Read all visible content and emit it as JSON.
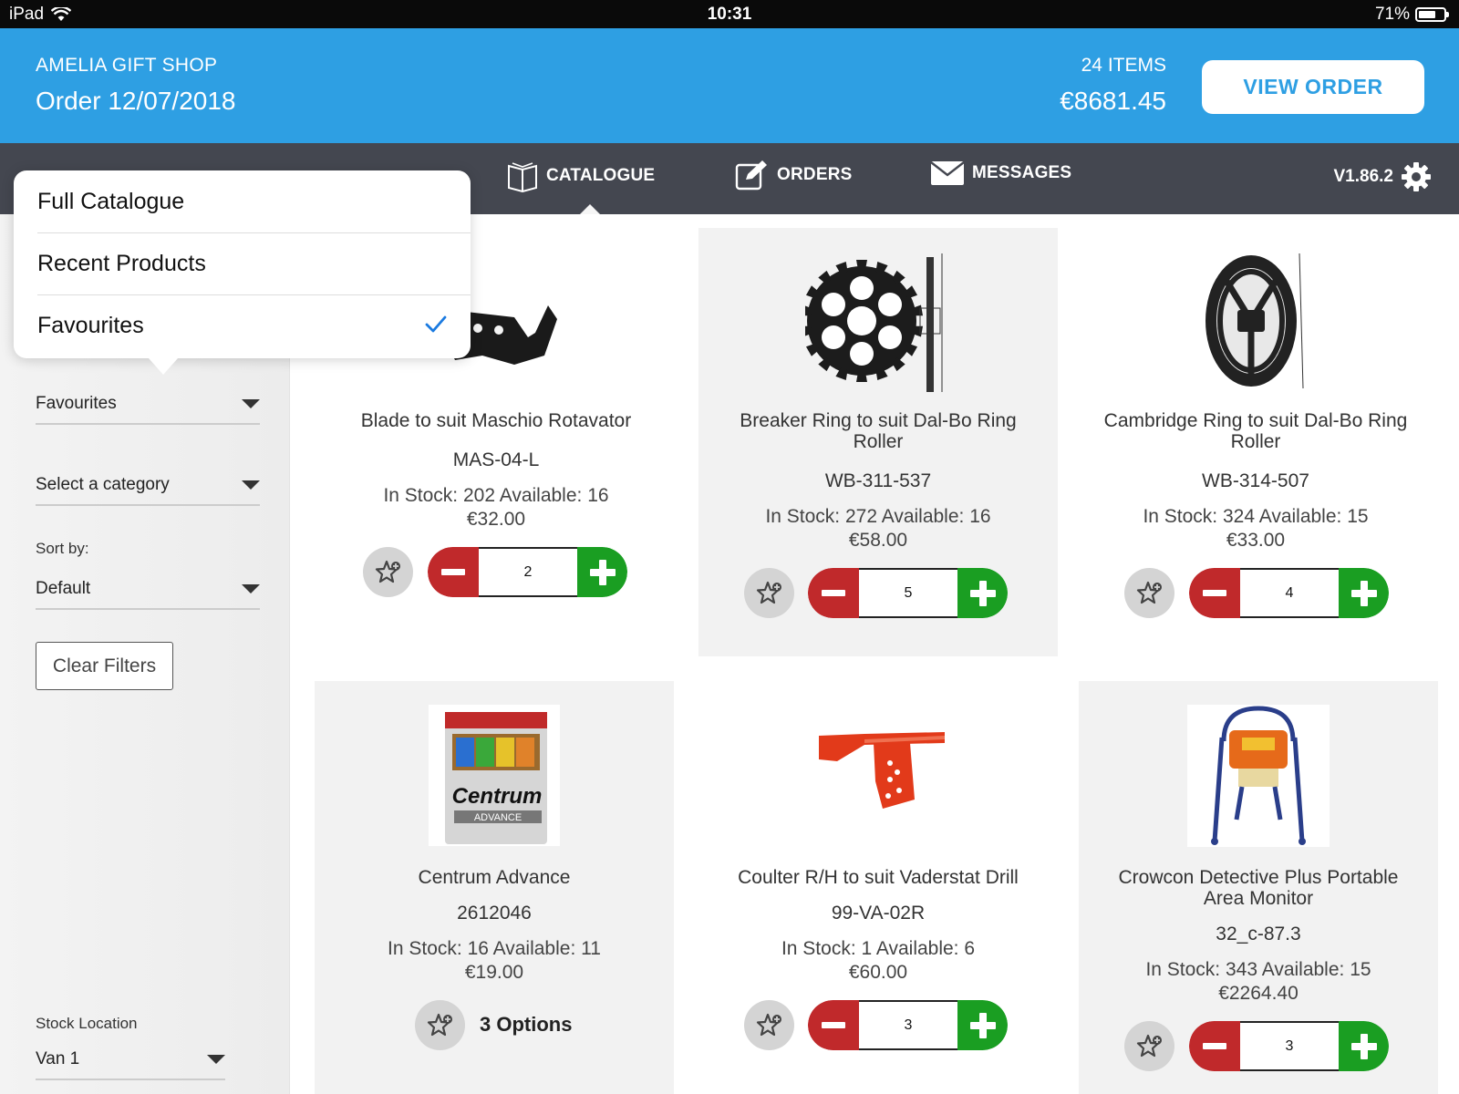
{
  "status_bar": {
    "device": "iPad",
    "time": "10:31",
    "battery": "71%",
    "battery_level": 0.71
  },
  "header": {
    "shop_name": "AMELIA GIFT SHOP",
    "order_label": "Order 12/07/2018",
    "item_count": "24 ITEMS",
    "order_total": "€8681.45",
    "view_order_label": "VIEW ORDER"
  },
  "nav": {
    "items": [
      {
        "label": "CATALOGUE",
        "icon": "book-icon"
      },
      {
        "label": "ORDERS",
        "icon": "edit-icon"
      },
      {
        "label": "MESSAGES",
        "icon": "envelope-icon"
      }
    ],
    "version": "V1.86.2",
    "settings_icon": "gear-icon"
  },
  "dropdown": {
    "items": [
      "Full Catalogue",
      "Recent Products",
      "Favourites"
    ],
    "selected": "Favourites"
  },
  "sidebar": {
    "catalogue_filter": "Favourites",
    "category_filter": "Select a category",
    "sort_label": "Sort by:",
    "sort_value": "Default",
    "clear_filters_label": "Clear Filters",
    "stock_location_label": "Stock Location",
    "stock_location_value": "Van 1"
  },
  "products": [
    {
      "name": "Blade to suit Maschio Rotavator",
      "code": "MAS-04-L",
      "stock": "In Stock: 202 Available: 16",
      "price": "€32.00",
      "qty": "2"
    },
    {
      "name": "Breaker Ring to suit Dal-Bo Ring Roller",
      "code": "WB-311-537",
      "stock": "In Stock: 272 Available: 16",
      "price": "€58.00",
      "qty": "5"
    },
    {
      "name": "Cambridge Ring to suit Dal-Bo Ring Roller",
      "code": "WB-314-507",
      "stock": "In Stock: 324 Available: 15",
      "price": "€33.00",
      "qty": "4"
    },
    {
      "name": "Centrum Advance",
      "code": "2612046",
      "stock": "In Stock: 16 Available: 11",
      "price": "€19.00",
      "options": "3 Options"
    },
    {
      "name": "Coulter R/H to suit Vaderstat Drill",
      "code": "99-VA-02R",
      "stock": "In Stock: 1 Available: 6",
      "price": "€60.00",
      "qty": "3"
    },
    {
      "name": "Crowcon Detective Plus Portable Area Monitor",
      "code": "32_c-87.3",
      "stock": "In Stock: 343 Available: 15",
      "price": "€2264.40",
      "qty": "3"
    }
  ],
  "product_image_labels": {
    "centrum_brand": "Centrum",
    "centrum_sub": "ADVANCE"
  }
}
